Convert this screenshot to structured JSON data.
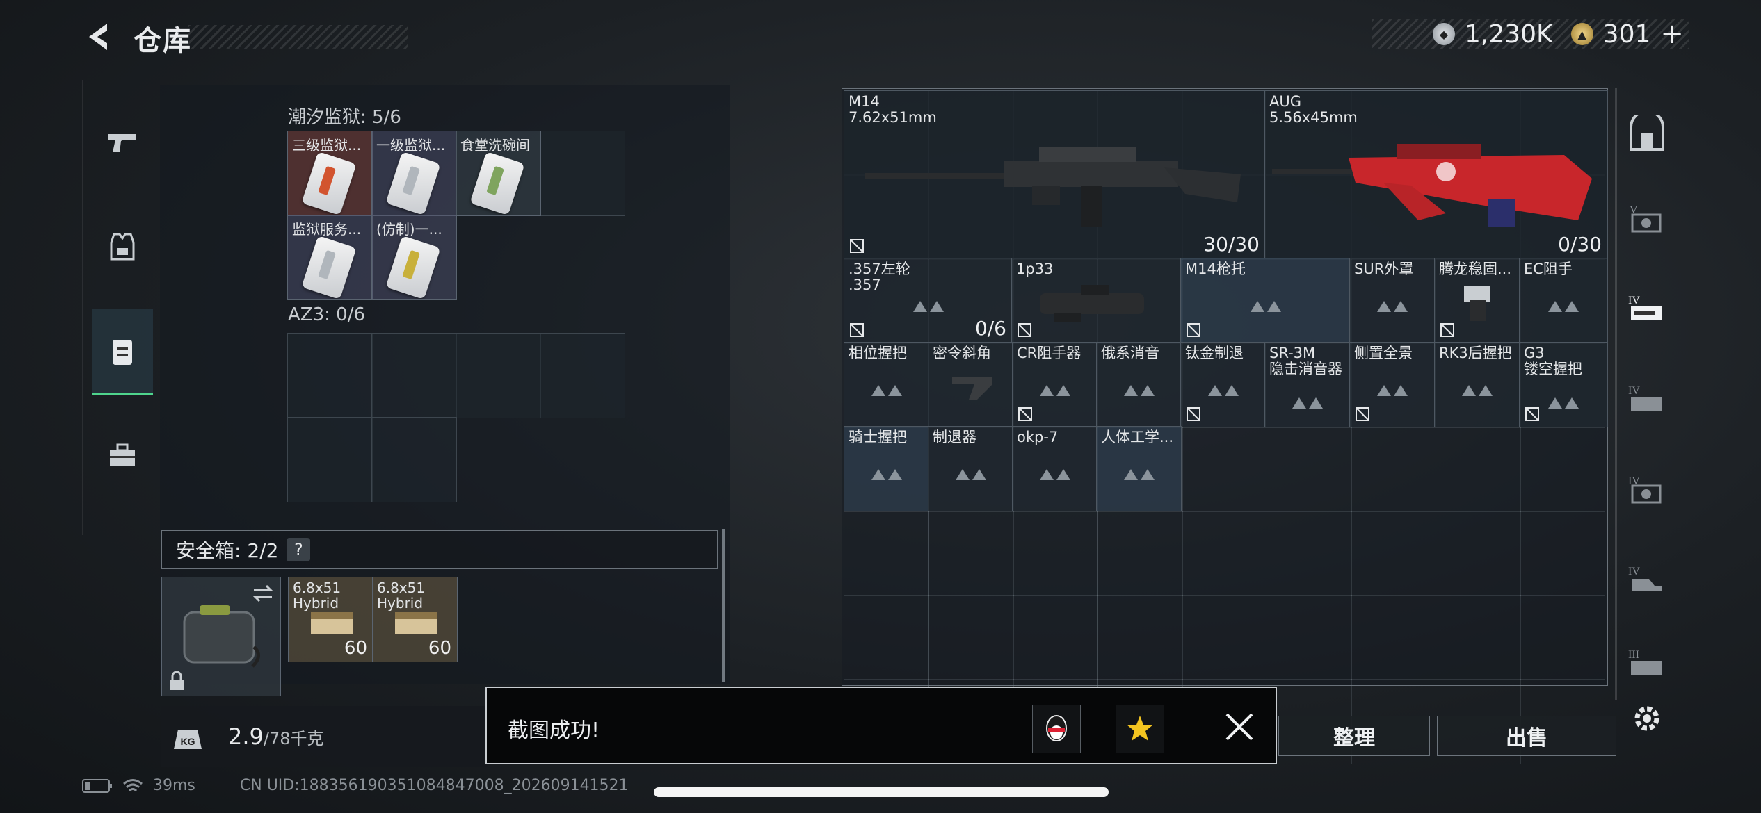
{
  "header": {
    "title": "仓库"
  },
  "currency": {
    "silver": "1,230K",
    "gold": "301"
  },
  "left_nav": [
    "pistol-icon",
    "armor-icon",
    "backpack-icon",
    "toolbox-icon"
  ],
  "storage": {
    "section1": {
      "label": "潮汐监狱: 5/6",
      "items": [
        "三级监狱...",
        "一级监狱...",
        "食堂洗碗间",
        "监狱服务...",
        "(仿制)一..."
      ]
    },
    "section2": {
      "label": "AZ3: 0/6"
    }
  },
  "safe_box": {
    "label": "安全箱: 2/2",
    "help": "?",
    "items": [
      {
        "name": "6.8x51",
        "sub": "Hybrid",
        "qty": "60"
      },
      {
        "name": "6.8x51",
        "sub": "Hybrid",
        "qty": "60"
      }
    ]
  },
  "weight": {
    "value": "2.9",
    "max": "/78千克"
  },
  "weapons": [
    {
      "name": "M14",
      "caliber": "7.62x51mm",
      "ammo": "30/30"
    },
    {
      "name": "AUG",
      "caliber": "5.56x45mm",
      "ammo": "0/30"
    }
  ],
  "attachments": {
    "row1": [
      {
        "name": ".357左轮",
        "sub": ".357",
        "qty": "0/6"
      },
      {
        "name": "1p33"
      },
      {
        "name": "M14枪托"
      },
      {
        "name": "SUR外罩"
      },
      {
        "name": "腾龙稳固..."
      },
      {
        "name": "EC阻手"
      }
    ],
    "row2": [
      {
        "name": "相位握把"
      },
      {
        "name": "密令斜角"
      },
      {
        "name": "CR阻手器"
      },
      {
        "name": "俄系消音"
      },
      {
        "name": "钛金制退"
      },
      {
        "name": "SR-3M",
        "sub": "隐击消音器"
      },
      {
        "name": "侧置全景"
      },
      {
        "name": "RK3后握把"
      },
      {
        "name": "G3",
        "sub": "镂空握把"
      }
    ],
    "row3": [
      {
        "name": "骑士握把"
      },
      {
        "name": "制退器"
      },
      {
        "name": "okp-7"
      },
      {
        "name": "人体工学..."
      }
    ]
  },
  "right_sidebar": [
    "vault-icon",
    "tier-v-icon",
    "tier-iv-icon",
    "tier-iv-icon",
    "tier-iv-icon",
    "tier-iv-icon",
    "tier-iii-icon",
    "settings-icon"
  ],
  "buttons": {
    "sort": "整理",
    "sell": "出售"
  },
  "toast": {
    "message": "截图成功!"
  },
  "status": {
    "ping": "39ms",
    "uid": "CN UID:1883561903510848470​08_202609141521"
  }
}
